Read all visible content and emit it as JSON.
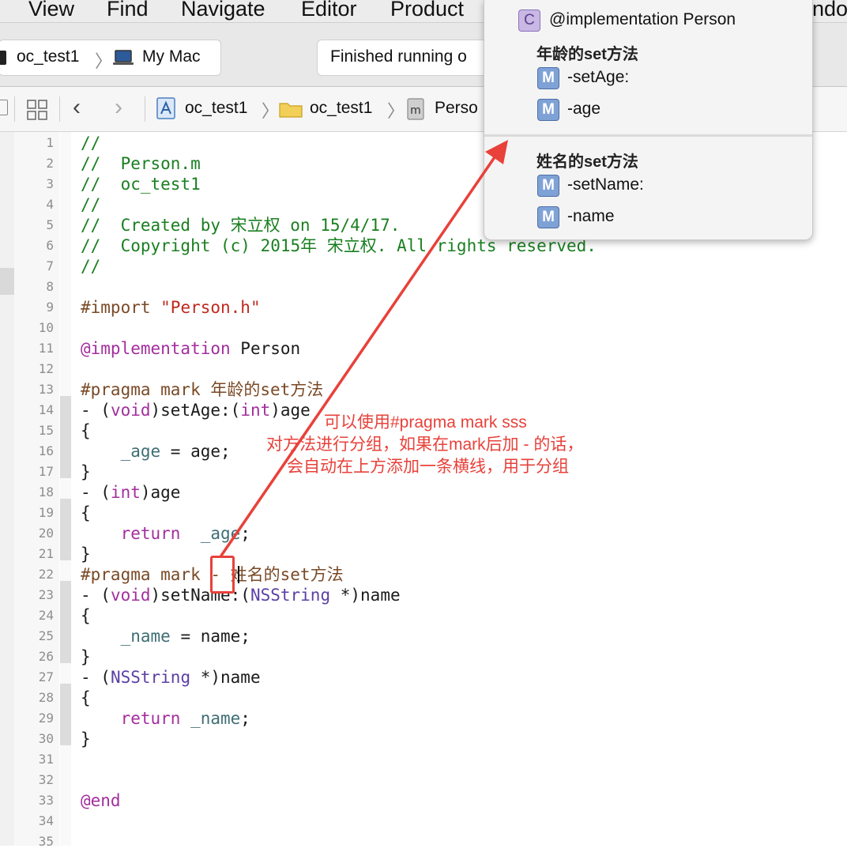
{
  "menubar": {
    "items": [
      {
        "label": "View"
      },
      {
        "label": "Find"
      },
      {
        "label": "Navigate"
      },
      {
        "label": "Editor"
      },
      {
        "label": "Product"
      },
      {
        "label": "ndo"
      }
    ]
  },
  "toolbar": {
    "scheme_target": "oc_test1",
    "scheme_device": "My Mac",
    "status_text": "Finished running o"
  },
  "jumpbar": {
    "crumbs": [
      "oc_test1",
      "oc_test1",
      "Perso"
    ]
  },
  "popup": {
    "class_badge": "C",
    "header": "@implementation Person",
    "method_badge": "M",
    "groups": [
      {
        "title": "年龄的set方法",
        "items": [
          "-setAge:",
          "-age"
        ]
      },
      {
        "title": "姓名的set方法",
        "items": [
          "-setName:",
          "-name"
        ]
      }
    ]
  },
  "editor": {
    "line_numbers": [
      "1",
      "2",
      "3",
      "4",
      "5",
      "6",
      "7",
      "8",
      "9",
      "10",
      "11",
      "12",
      "13",
      "14",
      "15",
      "16",
      "17",
      "18",
      "19",
      "20",
      "21",
      "22",
      "23",
      "24",
      "25",
      "26",
      "27",
      "28",
      "29",
      "30",
      "31",
      "32",
      "33",
      "34",
      "35"
    ],
    "lines": {
      "l1": "//",
      "l2": "//  Person.m",
      "l3": "//  oc_test1",
      "l4": "//",
      "l5": "//  Created by 宋立权 on 15/4/17.",
      "l6": "//  Copyright (c) 2015年 宋立权. All rights reserved.",
      "l7": "//",
      "l9_kw": "#import ",
      "l9_str": "\"Person.h\"",
      "l11_kw": "@implementation",
      "l11_rest": " Person",
      "l13": "#pragma mark 年龄的set方法",
      "l14_a": "- (",
      "l14_b": "void",
      "l14_c": ")setAge:(",
      "l14_d": "int",
      "l14_e": ")age",
      "l15": "{",
      "l16_ivar": "    _age",
      "l16_rest": " = age;",
      "l17": "}",
      "l18_a": "- (",
      "l18_b": "int",
      "l18_c": ")age",
      "l19": "{",
      "l20_kw": "    return",
      "l20_ivar": "  _age",
      "l20_rest": ";",
      "l21": "}",
      "l22": "#pragma mark - 姓名的set方法",
      "l23_a": "- (",
      "l23_b": "void",
      "l23_c": ")setName:(",
      "l23_d": "NSString",
      "l23_e": " *)name",
      "l24": "{",
      "l25_ivar": "    _name",
      "l25_rest": " = name;",
      "l26": "}",
      "l27_a": "- (",
      "l27_b": "NSString",
      "l27_c": " *)name",
      "l28": "{",
      "l29_kw": "    return",
      "l29_ivar": " _name",
      "l29_rest": ";",
      "l30": "}",
      "l33": "@end"
    }
  },
  "annotation": {
    "line1": "可以使用#pragma mark    sss",
    "line2": "对方法进行分组，如果在mark后加 - 的话，",
    "line3": "会自动在上方添加一条横线，用于分组",
    "color": "#e8413a"
  },
  "colors": {
    "comment": "#1a7f20",
    "keyword": "#a32e9e",
    "string": "#c0291f",
    "preprocessor": "#7a4a26",
    "type": "#5b3fa6",
    "ivar": "#3f6e74"
  }
}
